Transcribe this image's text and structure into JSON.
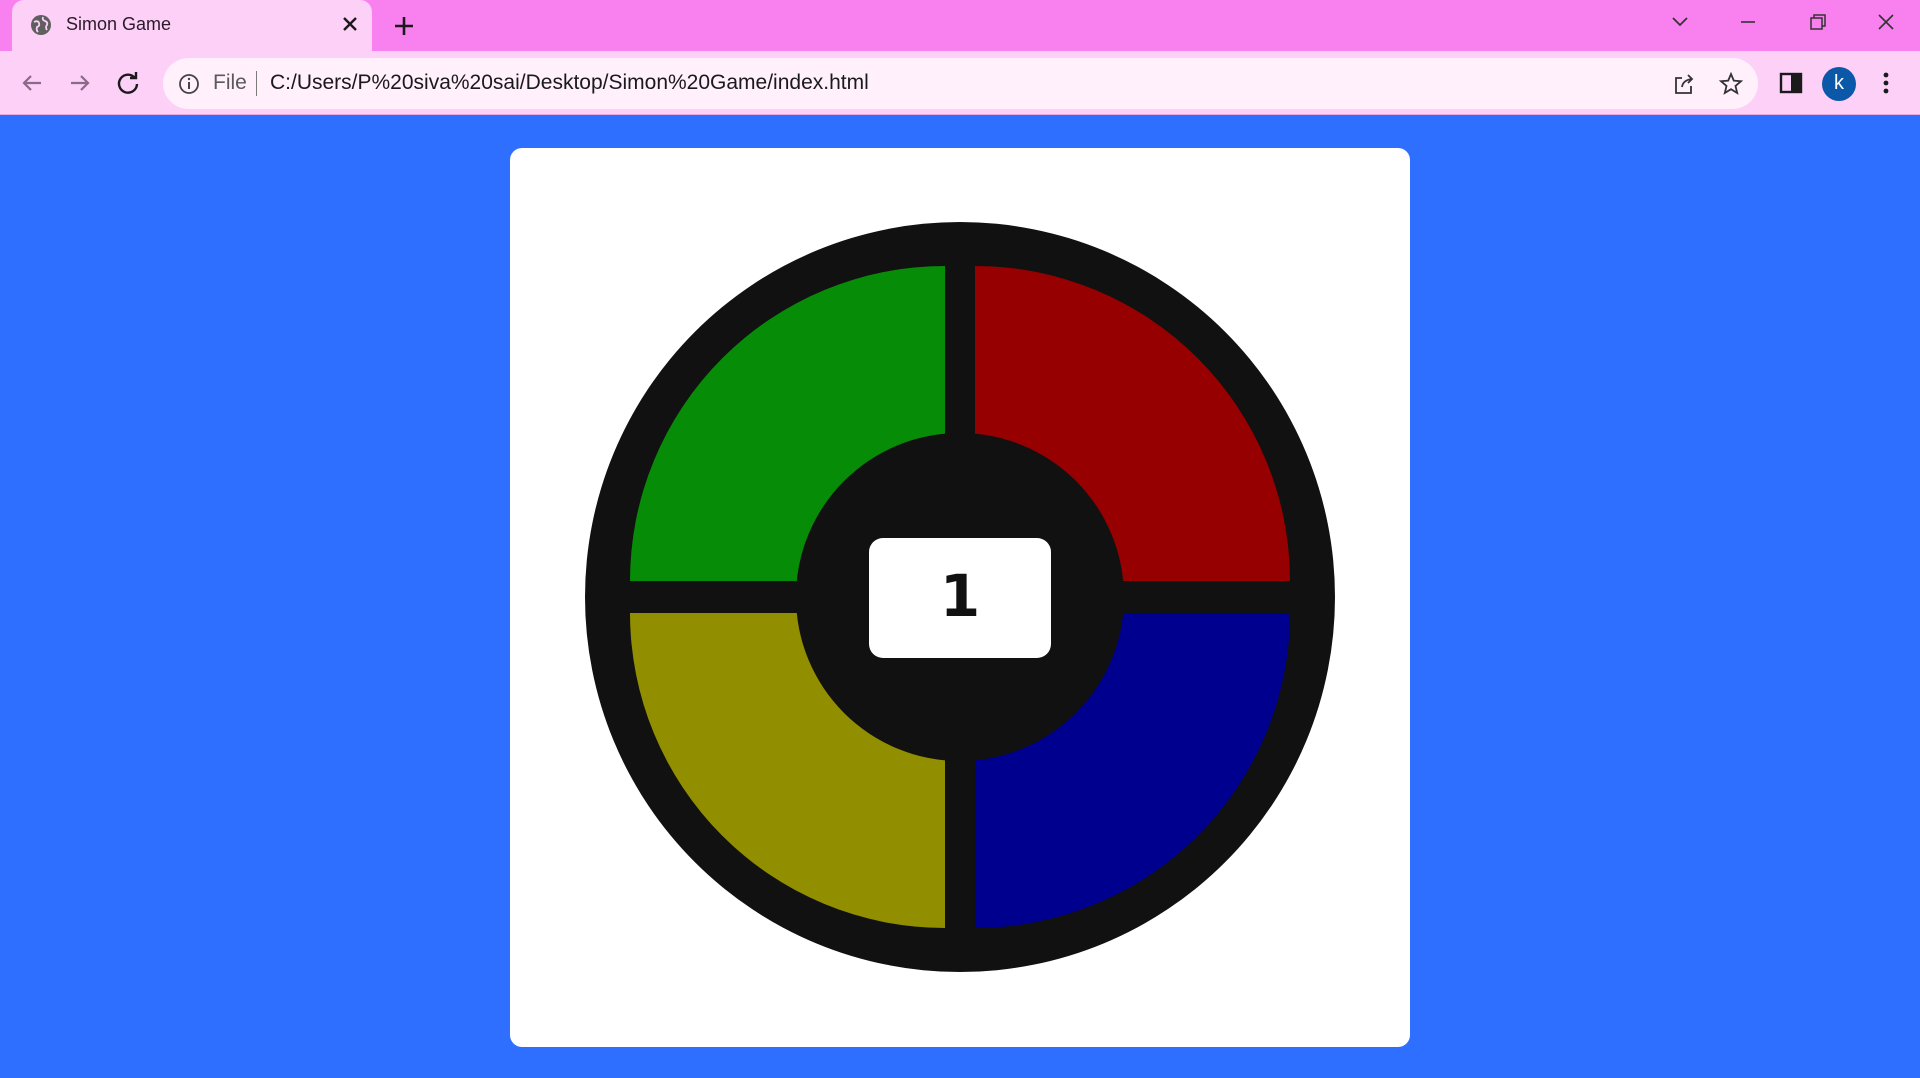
{
  "browser": {
    "tab": {
      "title": "Simon Game",
      "favicon": "globe-icon"
    },
    "address_bar": {
      "scheme_label": "File",
      "url": "C:/Users/P%20siva%20sai/Desktop/Simon%20Game/index.html"
    },
    "profile_initial": "k",
    "icons": [
      "back-icon",
      "forward-icon",
      "reload-icon",
      "info-icon",
      "share-icon",
      "star-icon",
      "side-panel-icon",
      "more-icon",
      "tab-search-icon",
      "minimize-icon",
      "restore-icon",
      "close-icon",
      "new-tab-icon"
    ]
  },
  "page": {
    "background": "#2f6fff",
    "game": {
      "score": "1",
      "colors": {
        "green": "#078c07",
        "red": "#960000",
        "yellow": "#918f00",
        "blue": "#00008f",
        "body": "#111111"
      }
    }
  }
}
